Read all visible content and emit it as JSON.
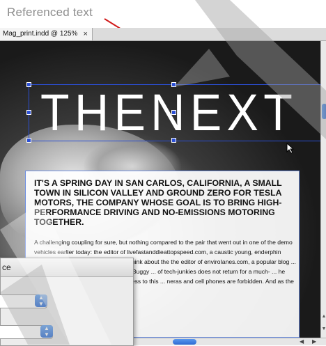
{
  "annotation": {
    "label": "Referenced text",
    "color": "#d11a1a"
  },
  "document": {
    "tab_title": "Mag_print.indd @ 125%",
    "close_glyph": "×"
  },
  "layout_content": {
    "headline": "THENEXT",
    "subhead": "IT'S A SPRING DAY IN SAN CARLOS, CALIFORNIA, A SMALL TOWN IN SILICON VALLEY AND GROUND ZERO FOR TESLA MOTORS, THE COMPANY WHOSE GOAL IS TO BRING HIGH-PERFORMANCE DRIVING AND NO-EMISSIONS MOTORING TOGETHER.",
    "body": "A challenging coupling for sure, but nothing compared to the pair that went out in one of the demo vehicles earlier today: the editor of livefastanddieattopspeed.com, a caustic young, enderphin junkie who is famous for saying, \"I'll think about the the editor of enviroIanes.com, a popular blog ... lly favorably reviewed the Horse and Buggy ... of tech-junkies does not return for a much- ... he factory. Up until this point getting access to this ... neras and cell phones are forbidden. And as the"
  },
  "dialog": {
    "title_partial": "ce"
  },
  "colors": {
    "selection_blue": "#2b4fd6",
    "scroll_thumb": "#2e6bd3"
  }
}
